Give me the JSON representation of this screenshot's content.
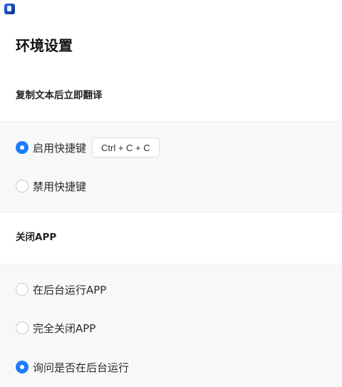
{
  "app": {
    "icon": "app-logo-icon"
  },
  "title": "环境设置",
  "sections": [
    {
      "header": "复制文本后立即翻译",
      "options": [
        {
          "label": "启用快捷键",
          "checked": true,
          "shortcut": "Ctrl + C + C"
        },
        {
          "label": "禁用快捷键",
          "checked": false
        }
      ]
    },
    {
      "header": "关闭APP",
      "options": [
        {
          "label": "在后台运行APP",
          "checked": false
        },
        {
          "label": "完全关闭APP",
          "checked": false
        },
        {
          "label": "询问是否在后台运行",
          "checked": true
        }
      ]
    }
  ],
  "colors": {
    "accent": "#1e7cf7",
    "panel": "#f7f8fa"
  }
}
